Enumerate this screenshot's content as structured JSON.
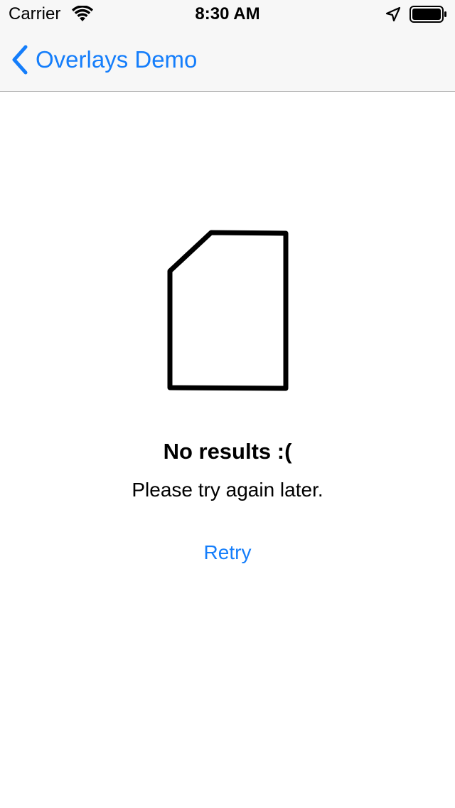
{
  "status_bar": {
    "carrier": "Carrier",
    "time": "8:30 AM",
    "icons": [
      "wifi-icon",
      "location-arrow-icon",
      "battery-icon"
    ]
  },
  "nav_bar": {
    "back_label": "Overlays Demo",
    "back_icon": "chevron-left-icon",
    "accent_color": "#157efb"
  },
  "empty_state": {
    "icon": "document-icon",
    "title": "No results :(",
    "message": "Please try again later.",
    "retry_label": "Retry"
  }
}
